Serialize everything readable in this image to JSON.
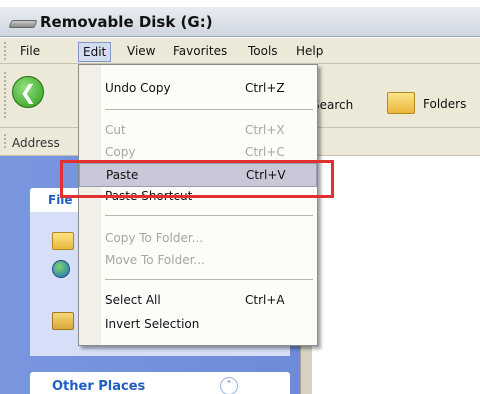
{
  "window": {
    "title": "Removable Disk (G:)"
  },
  "menubar": {
    "items": [
      "File",
      "Edit",
      "View",
      "Favorites",
      "Tools",
      "Help"
    ]
  },
  "toolbar": {
    "search_label": "Search",
    "folders_label": "Folders"
  },
  "address": {
    "label": "Address"
  },
  "left_pane": {
    "tasks_heading": "File",
    "other_places_heading": "Other Places"
  },
  "edit_menu": {
    "items": [
      {
        "label": "Undo Copy",
        "shortcut": "Ctrl+Z",
        "enabled": true
      },
      {
        "label": "Cut",
        "shortcut": "Ctrl+X",
        "enabled": false
      },
      {
        "label": "Copy",
        "shortcut": "Ctrl+C",
        "enabled": false
      },
      {
        "label": "Paste",
        "shortcut": "Ctrl+V",
        "enabled": true,
        "highlighted": true
      },
      {
        "label": "Paste Shortcut",
        "shortcut": "",
        "enabled": true
      },
      {
        "label": "Copy To Folder...",
        "shortcut": "",
        "enabled": false
      },
      {
        "label": "Move To Folder...",
        "shortcut": "",
        "enabled": false
      },
      {
        "label": "Select All",
        "shortcut": "Ctrl+A",
        "enabled": true
      },
      {
        "label": "Invert Selection",
        "shortcut": "",
        "enabled": true
      }
    ]
  },
  "icons": {
    "back": "back-arrow-icon",
    "folders": "folders-icon",
    "drive": "removable-disk-icon",
    "collapse": "collapse-chevron-icon"
  },
  "colors": {
    "highlight_box": "#e03030",
    "link_blue": "#215dc6"
  }
}
